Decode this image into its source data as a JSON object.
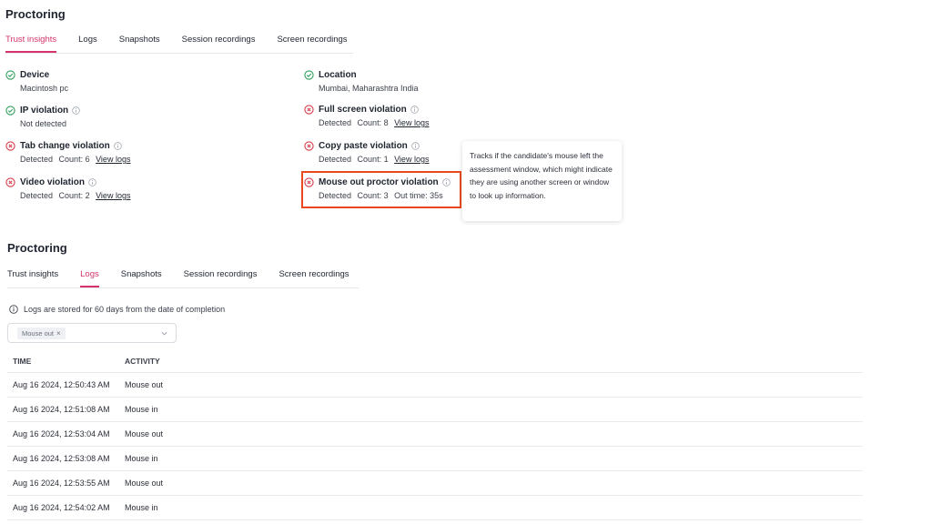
{
  "section1": {
    "title": "Proctoring",
    "tabs": [
      {
        "label": "Trust insights",
        "active": true
      },
      {
        "label": "Logs",
        "active": false
      },
      {
        "label": "Snapshots",
        "active": false
      },
      {
        "label": "Session recordings",
        "active": false
      },
      {
        "label": "Screen recordings",
        "active": false
      }
    ]
  },
  "insights": {
    "device": {
      "title": "Device",
      "status": "ok",
      "detail": "Macintosh pc"
    },
    "location": {
      "title": "Location",
      "status": "ok",
      "detail": "Mumbai, Maharashtra India"
    },
    "ip": {
      "title": "IP violation",
      "status": "ok",
      "detail": "Not detected"
    },
    "fullscreen": {
      "title": "Full screen violation",
      "status": "violation",
      "detected": "Detected",
      "count": "Count: 8",
      "link": "View logs"
    },
    "tab_change": {
      "title": "Tab change violation",
      "status": "violation",
      "detected": "Detected",
      "count": "Count: 6",
      "link": "View logs"
    },
    "copy_paste": {
      "title": "Copy paste violation",
      "status": "violation",
      "detected": "Detected",
      "count": "Count: 1",
      "link": "View logs"
    },
    "video": {
      "title": "Video violation",
      "status": "violation",
      "detected": "Detected",
      "count": "Count: 2",
      "link": "View logs"
    },
    "mouse_out": {
      "title": "Mouse out proctor violation",
      "status": "violation",
      "detected": "Detected",
      "count": "Count: 3",
      "out_time": "Out time: 35s"
    }
  },
  "tooltip": {
    "text": "Tracks if the candidate's mouse left the assessment window, which might indicate they are using another screen or window to look up information."
  },
  "section2": {
    "title": "Proctoring",
    "tabs": [
      {
        "label": "Trust insights",
        "active": false
      },
      {
        "label": "Logs",
        "active": true
      },
      {
        "label": "Snapshots",
        "active": false
      },
      {
        "label": "Session recordings",
        "active": false
      },
      {
        "label": "Screen recordings",
        "active": false
      }
    ],
    "logs_note": "Logs are stored for 60 days from the date of completion",
    "filter_chip": "Mouse out",
    "filter_chip_remove": "×",
    "table": {
      "headers": {
        "time": "TIME",
        "activity": "ACTIVITY"
      },
      "rows": [
        {
          "time": "Aug 16 2024, 12:50:43 AM",
          "activity": "Mouse out"
        },
        {
          "time": "Aug 16 2024, 12:51:08 AM",
          "activity": "Mouse in"
        },
        {
          "time": "Aug 16 2024, 12:53:04 AM",
          "activity": "Mouse out"
        },
        {
          "time": "Aug 16 2024, 12:53:08 AM",
          "activity": "Mouse in"
        },
        {
          "time": "Aug 16 2024, 12:53:55 AM",
          "activity": "Mouse out"
        },
        {
          "time": "Aug 16 2024, 12:54:02 AM",
          "activity": "Mouse in"
        }
      ]
    }
  },
  "colors": {
    "accent": "#d6336c",
    "ok": "#2e9e5b",
    "violation": "#d93b4a",
    "highlight": "#e8491f"
  }
}
